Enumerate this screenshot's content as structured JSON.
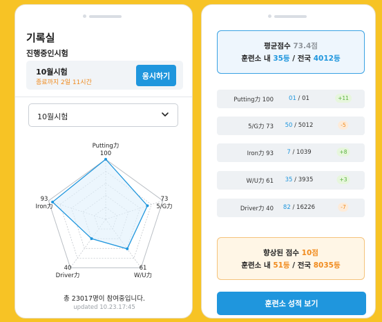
{
  "left": {
    "title": "기록실",
    "subtitle": "진행중인시험",
    "exam": {
      "name": "10월시험",
      "deadline": "종료까지 2일 11시간",
      "apply_label": "응시하기"
    },
    "select": {
      "value": "10월시험"
    },
    "radar": {
      "axes": [
        {
          "name": "Putting力",
          "score": "100",
          "value": 100
        },
        {
          "name": "5/G力",
          "score": "73",
          "value": 73
        },
        {
          "name": "W/U力",
          "score": "61",
          "value": 61
        },
        {
          "name": "Driver力",
          "score": "40",
          "value": 40
        },
        {
          "name": "Iron力",
          "score": "93",
          "value": 93
        }
      ],
      "max": 100,
      "colors": {
        "line": "#1f96dd",
        "fill": "#dff0fb",
        "grid": "#b9bec4"
      }
    },
    "participants": "총 23017명이 참여중입니다.",
    "updated": "updated 10.23.17:45"
  },
  "right": {
    "average": {
      "label": "평균점수",
      "value": "73.4점",
      "center_label": "훈련소 내",
      "center_rank": "35등",
      "separator": "/",
      "national_label": "전국",
      "national_rank": "4012등"
    },
    "rows": [
      {
        "label": "Putting力 100",
        "rank": "01",
        "total": "01",
        "delta": "+11",
        "trend": "up"
      },
      {
        "label": "5/G力 73",
        "rank": "50",
        "total": "5012",
        "delta": "-5",
        "trend": "down"
      },
      {
        "label": "Iron力 93",
        "rank": "7",
        "total": "1039",
        "delta": "+8",
        "trend": "up"
      },
      {
        "label": "W/U力 61",
        "rank": "35",
        "total": "3935",
        "delta": "+3",
        "trend": "up"
      },
      {
        "label": "Driver力 40",
        "rank": "82",
        "total": "16226",
        "delta": "-7",
        "trend": "down"
      }
    ],
    "improved": {
      "label": "향상된 점수",
      "value": "10점",
      "center_label": "훈련소 내",
      "center_rank": "51등",
      "separator": "/",
      "national_label": "전국",
      "national_rank": "8035등"
    },
    "report_button": "훈련소 성적 보기"
  },
  "colors": {
    "accent": "#1f96dd",
    "orange": "#f08a1c",
    "background": "#f7c325"
  }
}
